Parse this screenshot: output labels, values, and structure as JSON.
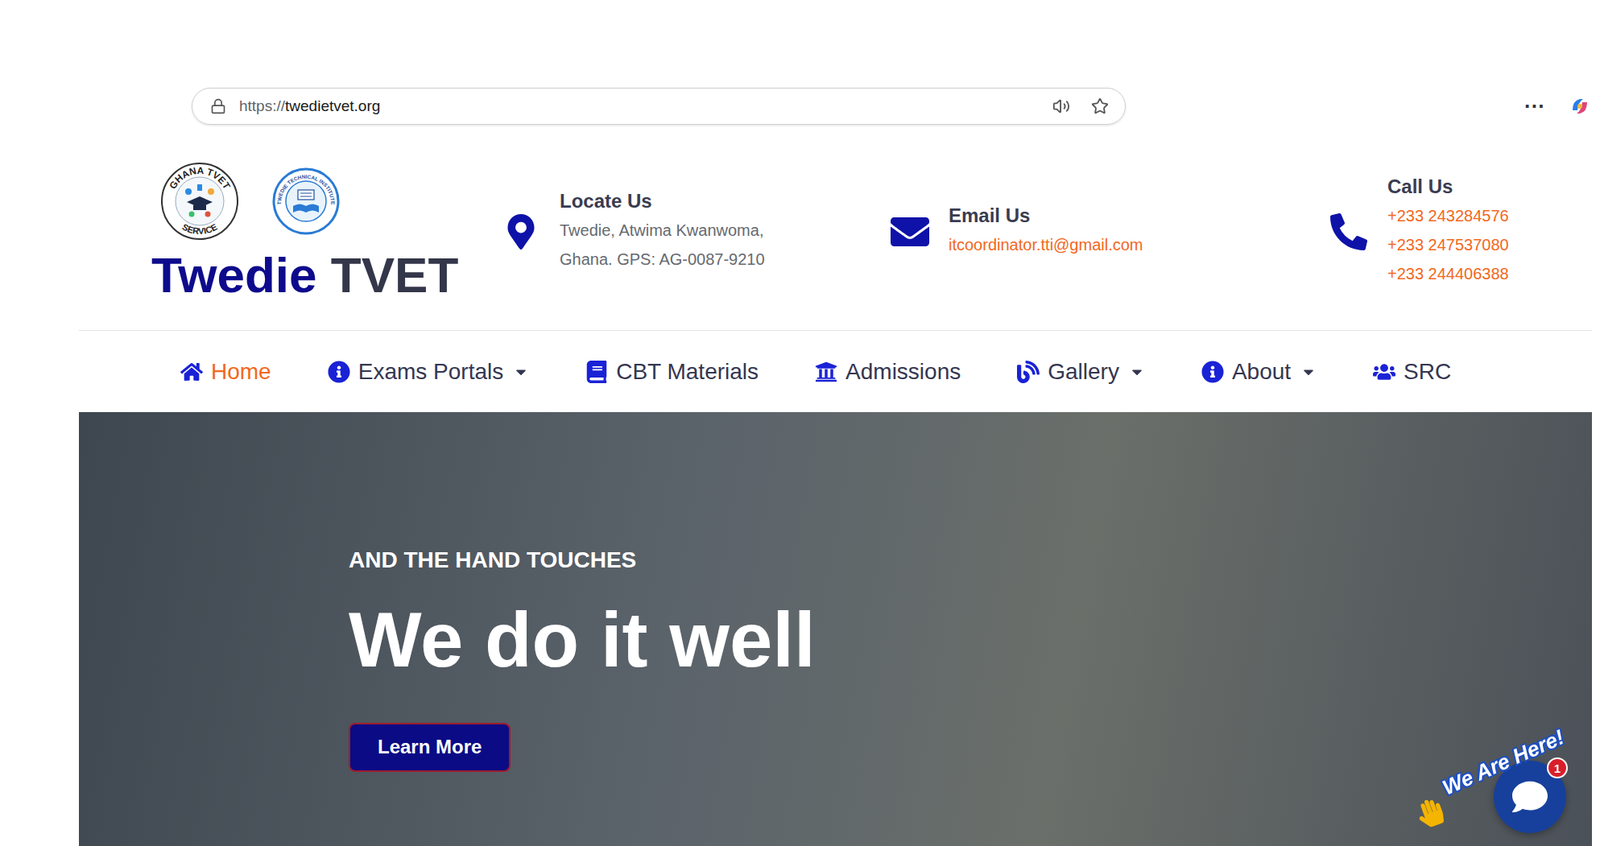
{
  "browser": {
    "url_scheme": "https://",
    "url_host": "twedietvet.org",
    "menu": "···"
  },
  "header": {
    "logos": [
      {
        "kind": "seal",
        "arc_top": "GHANA TVET",
        "arc_bottom": "SERVICE"
      },
      {
        "kind": "crest",
        "arc_top": "TWEDIE TECHNICAL INSTITUTE"
      }
    ],
    "brand": {
      "first": "Twedie",
      "second": "TVET"
    },
    "contacts": [
      {
        "title": "Locate Us",
        "kind": "address",
        "lines": [
          "Twedie, Atwima Kwanwoma,",
          "Ghana. GPS: AG-0087-9210"
        ]
      },
      {
        "title": "Email Us",
        "kind": "link",
        "lines": [
          "itcoordinator.tti@gmail.com"
        ]
      },
      {
        "title": "Call Us",
        "kind": "link",
        "lines": [
          "+233 243284576",
          "+233 247537080",
          "+233 244406388"
        ]
      }
    ]
  },
  "nav": [
    {
      "label": "Home",
      "selected": true,
      "dropdown": false
    },
    {
      "label": "Exams Portals",
      "selected": false,
      "dropdown": true
    },
    {
      "label": "CBT Materials",
      "selected": false,
      "dropdown": false
    },
    {
      "label": "Admissions",
      "selected": false,
      "dropdown": false
    },
    {
      "label": "Gallery",
      "selected": false,
      "dropdown": true
    },
    {
      "label": "About",
      "selected": false,
      "dropdown": true
    },
    {
      "label": "SRC",
      "selected": false,
      "dropdown": false
    }
  ],
  "hero": {
    "kicker": "AND THE HAND TOUCHES",
    "title": "We do it well",
    "button": "Learn More"
  },
  "chat": {
    "label": "We Are Here!",
    "badge": "1"
  }
}
